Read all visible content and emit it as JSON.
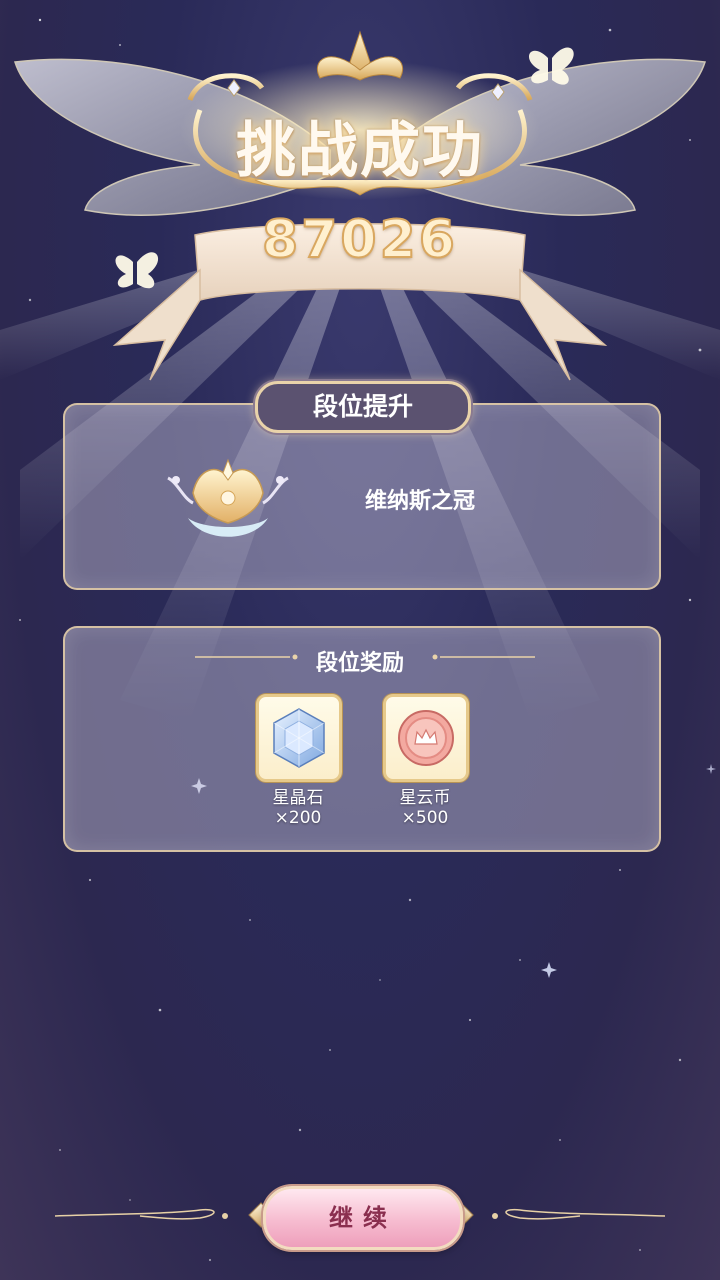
{
  "header": {
    "title": "挑战成功",
    "score": "87026"
  },
  "rank_panel": {
    "tab_label": "段位提升",
    "rank_name": "维纳斯之冠"
  },
  "reward_panel": {
    "heading": "段位奖励",
    "items": [
      {
        "name": "星晶石",
        "qty": "×200",
        "icon": "crystal-icon"
      },
      {
        "name": "星云币",
        "qty": "×500",
        "icon": "coin-icon"
      }
    ]
  },
  "footer": {
    "continue_label": "继续"
  },
  "colors": {
    "panel_border": "#e8d0a8",
    "button_pink": "#f6bcd0",
    "gold": "#d9a75f"
  }
}
